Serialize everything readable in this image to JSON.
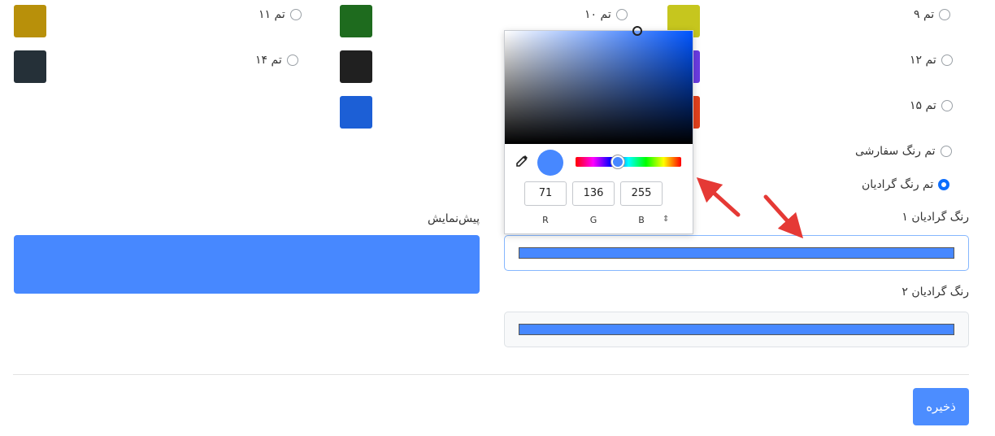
{
  "themes": [
    {
      "label": "تم ۹",
      "checked": false
    },
    {
      "label": "تم ۱۰",
      "checked": false
    },
    {
      "label": "تم ۱۱",
      "checked": false
    },
    {
      "label": "تم ۱۲",
      "checked": false
    },
    {
      "label": "تم ۱۴",
      "checked": false
    },
    {
      "label": "تم ۱۵",
      "checked": false
    },
    {
      "label": "تم رنگ سفارشی",
      "checked": false
    },
    {
      "label": "تم رنگ گرادیان",
      "checked": true
    }
  ],
  "swatch_colors": [
    "#b8900a",
    "#1e6b1e",
    "#c6c61e",
    "#253038",
    "#202020",
    "#6a3be0",
    "#1c5fd6",
    "#e0401c"
  ],
  "gradient1": {
    "label": "رنگ گرادیان ۱",
    "color": "#4788ff"
  },
  "gradient2": {
    "label": "رنگ گرادیان ۲",
    "color": "#4788ff"
  },
  "preview": {
    "label": "پیش‌نمایش",
    "color": "#4788ff"
  },
  "save_label": "ذخیره",
  "accent": "#4c8dff",
  "picker": {
    "r": "71",
    "g": "136",
    "b": "255",
    "r_label": "R",
    "g_label": "G",
    "b_label": "B",
    "mode_toggle": "⇕",
    "hue_position": 0.4,
    "eyedropper_icon": "eyedropper-icon"
  }
}
